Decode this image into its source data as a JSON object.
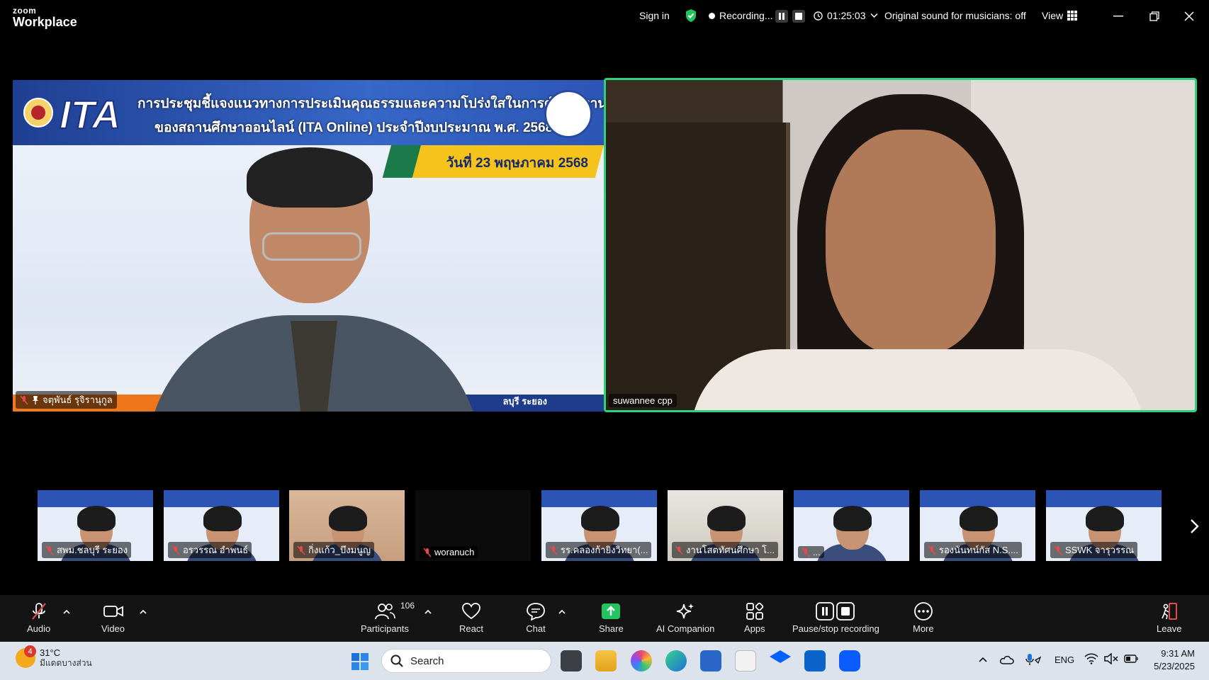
{
  "titlebar": {
    "logo_top": "zoom",
    "logo_bottom": "Workplace",
    "sign_in": "Sign in",
    "recording_label": "Recording...",
    "timer": "01:25:03",
    "original_sound": "Original sound for musicians: off",
    "view_label": "View"
  },
  "main_tiles": {
    "left": {
      "name": "จตุพันธ์ รุจิรานุกูล",
      "slide_title_line1": "การประชุมชี้แจงแนวทางการประเมินคุณธรรมและความโปร่งใสในการดำเนินงาน",
      "slide_title_line2": "ของสถานศึกษาออนไลน์ (ITA Online) ประจำปีงบประมาณ พ.ศ. 2568",
      "slide_date": "วันที่ 23 พฤษภาคม 2568",
      "slide_logo": "ITA",
      "slide_footer": "ลบุรี ระยอง"
    },
    "right": {
      "name": "suwannee cpp"
    }
  },
  "gallery": [
    {
      "name": "สพม.ชลบุรี ระยอง",
      "style": "slide"
    },
    {
      "name": "อรวรรณ อำพนธ์",
      "style": "slide"
    },
    {
      "name": "กิ่งแก้ว_บึงมนูญ",
      "style": "warm"
    },
    {
      "name": "woranuch",
      "style": "black"
    },
    {
      "name": "รร.คลองก้ายิงวิทยา(...",
      "style": "slide"
    },
    {
      "name": "งานโสตทัศนศึกษา โ...",
      "style": "room"
    },
    {
      "name": "...",
      "style": "slide"
    },
    {
      "name": "รองนันทน์กัส N.S....",
      "style": "slide"
    },
    {
      "name": "SSWK จารุวรรณ",
      "style": "slide"
    }
  ],
  "toolbar": {
    "audio": "Audio",
    "video": "Video",
    "participants": "Participants",
    "participants_count": "106",
    "react": "React",
    "chat": "Chat",
    "share": "Share",
    "ai_companion": "AI Companion",
    "apps": "Apps",
    "pause_stop": "Pause/stop recording",
    "more": "More",
    "leave": "Leave"
  },
  "taskbar": {
    "weather_badge": "4",
    "temperature": "31°C",
    "weather_desc": "มีแดดบางส่วน",
    "search_label": "Search",
    "language": "ENG",
    "time": "9:31 AM",
    "date": "5/23/2025"
  },
  "colors": {
    "active_speaker_border": "#2fd17b",
    "share_green": "#23c45e",
    "mute_red": "#e5484d"
  }
}
